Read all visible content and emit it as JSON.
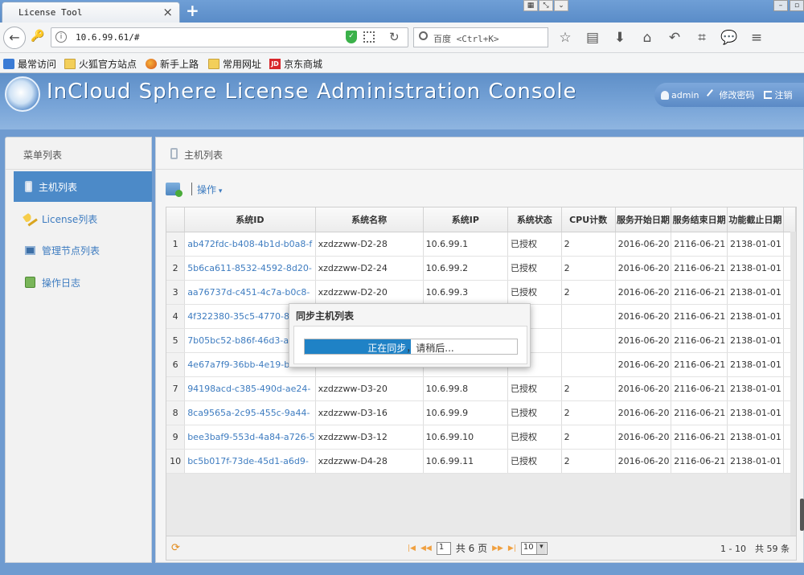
{
  "browser": {
    "tab_title": "License Tool",
    "url": "10.6.99.61/#",
    "search_placeholder": "百度 <Ctrl+K>",
    "bookmarks": [
      "最常访问",
      "火狐官方站点",
      "新手上路",
      "常用网址",
      "京东商城"
    ]
  },
  "app": {
    "title": "InCloud Sphere License Administration Console",
    "user": "admin",
    "change_password": "修改密码",
    "logout": "注销"
  },
  "sidebar": {
    "heading": "菜单列表",
    "items": [
      {
        "label": "主机列表",
        "active": true
      },
      {
        "label": "License列表",
        "active": false
      },
      {
        "label": "管理节点列表",
        "active": false
      },
      {
        "label": "操作日志",
        "active": false
      }
    ]
  },
  "main": {
    "heading": "主机列表",
    "toolbar_op": "操作",
    "columns": [
      "系统ID",
      "系统名称",
      "系统IP",
      "系统状态",
      "CPU计数",
      "服务开始日期",
      "服务结束日期",
      "功能截止日期"
    ],
    "rows": [
      [
        "1",
        "ab472fdc-b408-4b1d-b0a8-f",
        "xzdzzww-D2-28",
        "10.6.99.1",
        "已授权",
        "2",
        "2016-06-20",
        "2116-06-21",
        "2138-01-01"
      ],
      [
        "2",
        "5b6ca611-8532-4592-8d20-",
        "xzdzzww-D2-24",
        "10.6.99.2",
        "已授权",
        "2",
        "2016-06-20",
        "2116-06-21",
        "2138-01-01"
      ],
      [
        "3",
        "aa76737d-c451-4c7a-b0c8-",
        "xzdzzww-D2-20",
        "10.6.99.3",
        "已授权",
        "2",
        "2016-06-20",
        "2116-06-21",
        "2138-01-01"
      ],
      [
        "4",
        "4f322380-35c5-4770-8220",
        "",
        "",
        "",
        "",
        "2016-06-20",
        "2116-06-21",
        "2138-01-01"
      ],
      [
        "5",
        "7b05bc52-b86f-46d3-ad9",
        "",
        "",
        "",
        "",
        "2016-06-20",
        "2116-06-21",
        "2138-01-01"
      ],
      [
        "6",
        "4e67a7f9-36bb-4e19-be62",
        "",
        "",
        "",
        "",
        "2016-06-20",
        "2116-06-21",
        "2138-01-01"
      ],
      [
        "7",
        "94198acd-c385-490d-ae24-",
        "xzdzzww-D3-20",
        "10.6.99.8",
        "已授权",
        "2",
        "2016-06-20",
        "2116-06-21",
        "2138-01-01"
      ],
      [
        "8",
        "8ca9565a-2c95-455c-9a44-",
        "xzdzzww-D3-16",
        "10.6.99.9",
        "已授权",
        "2",
        "2016-06-20",
        "2116-06-21",
        "2138-01-01"
      ],
      [
        "9",
        "bee3baf9-553d-4a84-a726-5",
        "xzdzzww-D3-12",
        "10.6.99.10",
        "已授权",
        "2",
        "2016-06-20",
        "2116-06-21",
        "2138-01-01"
      ],
      [
        "10",
        "bc5b017f-73de-45d1-a6d9-",
        "xzdzzww-D4-28",
        "10.6.99.11",
        "已授权",
        "2",
        "2016-06-20",
        "2116-06-21",
        "2138-01-01"
      ]
    ],
    "pager": {
      "page": "1",
      "total_pages": "共 6 页",
      "page_size": "10",
      "info": "1 - 10　共 59 条"
    }
  },
  "modal": {
    "title": "同步主机列表",
    "progress_highlight": "正在同步",
    "progress_rest": "，请稍后...",
    "progress_fraction": 0.5
  }
}
